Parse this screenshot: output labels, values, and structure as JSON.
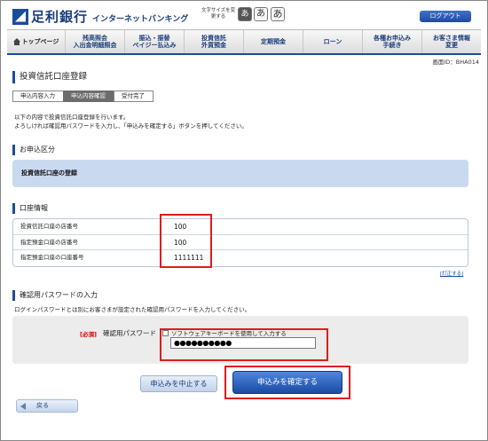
{
  "header": {
    "bank_name": "足利銀行",
    "service_name": "インターネットバンキング",
    "font_size_label": "文字サイズを変更する",
    "font_sizes": [
      "あ",
      "あ",
      "あ"
    ],
    "logout_label": "ログアウト"
  },
  "nav": {
    "items": [
      {
        "label": "トップページ"
      },
      {
        "label": "残高照会\n入出金明細照会"
      },
      {
        "label": "振込・振替\nペイジー払込み"
      },
      {
        "label": "投資信託\n外貨預金"
      },
      {
        "label": "定期預金"
      },
      {
        "label": "ローン"
      },
      {
        "label": "各種お申込み\n手続き"
      },
      {
        "label": "お客さま情報\n変更"
      }
    ]
  },
  "screen_id": "画面ID：BHA014",
  "page_title": "投資信託口座登録",
  "steps": [
    "申込内容入力",
    "申込内容確認",
    "受付完了"
  ],
  "intro": {
    "line1": "以下の内容で投資信託口座登録を行います。",
    "line2": "よろしければ確認用パスワードを入力し、「申込みを確定する」ボタンを押してください。"
  },
  "application": {
    "heading": "お申込区分",
    "value": "投資信託口座の登録"
  },
  "account": {
    "heading": "口座情報",
    "rows": [
      {
        "label": "投資信託口座の店番号",
        "value": "100"
      },
      {
        "label": "指定預金口座の店番号",
        "value": "100"
      },
      {
        "label": "指定預金口座の口座番号",
        "value": "1111111"
      }
    ],
    "correct_link": "[訂正する]"
  },
  "password": {
    "heading": "確認用パスワードの入力",
    "description": "ログインパスワードとは別にお客さまが設定された確認用パスワードを入力してください。",
    "required_label": "[必須]",
    "label": "確認用パスワード",
    "software_keyboard_label": "ソフトウェアキーボードを使用して入力する",
    "value": "●●●●●●●●●●"
  },
  "buttons": {
    "cancel": "申込みを中止する",
    "confirm": "申込みを確定する",
    "back": "戻る"
  },
  "colors": {
    "brand": "#1a4c9c",
    "highlight": "#e01c1c"
  }
}
